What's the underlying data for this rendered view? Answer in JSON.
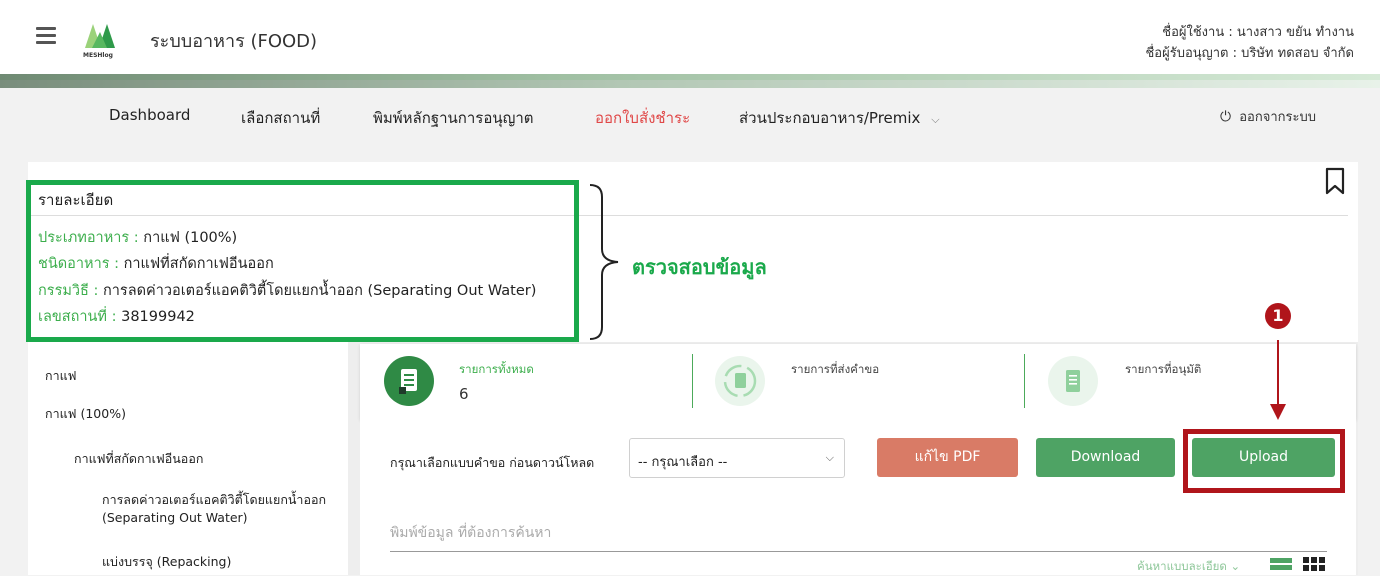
{
  "header": {
    "app_title": "ระบบอาหาร (FOOD)",
    "logo_text": "MESHlog",
    "user_line": "ชื่อผู้ใช้งาน : นางสาว ขยัน ทำงาน",
    "licensee_line": "ชื่อผู้รับอนุญาต : บริษัท ทดสอบ จำกัด",
    "brand_color": "#1aa94b"
  },
  "nav": {
    "items": [
      {
        "label": "Dashboard",
        "active": false
      },
      {
        "label": "เลือกสถานที่",
        "active": false
      },
      {
        "label": "พิมพ์หลักฐานการอนุญาต",
        "active": false
      },
      {
        "label": "ออกใบสั่งชำระ",
        "active": true
      },
      {
        "label": "ส่วนประกอบอาหาร/Premix",
        "active": false
      }
    ],
    "dropdown_indicator": "⌵",
    "logout_icon": "⏻",
    "logout_label": "ออกจากระบบ"
  },
  "details": {
    "title": "รายละเอียด",
    "lines": [
      {
        "label": "ประเภทอาหาร :",
        "value": "กาแฟ (100%)"
      },
      {
        "label": "ชนิดอาหาร :",
        "value": "กาแฟที่สกัดกาเฟอีนออก"
      },
      {
        "label": "กรรมวิธี :",
        "value": "การลดค่าวอเตอร์แอคติวิตี้โดยแยกน้ำออก (Separating Out Water)"
      },
      {
        "label": "เลขสถานที่ :",
        "value": "38199942"
      }
    ],
    "annotation": "ตรวจสอบข้อมูล"
  },
  "sidebar": {
    "items": [
      "กาแฟ",
      "กาแฟ (100%)",
      "กาแฟที่สกัดกาเฟอีนออก",
      "การลดค่าวอเตอร์แอคติวิตี้โดยแยกน้ำออก",
      "(Separating Out Water)",
      "แบ่งบรรจุ (Repacking)"
    ]
  },
  "stats": [
    {
      "label": "รายการทั้งหมด",
      "value": "6",
      "icon": "document-icon"
    },
    {
      "label": "รายการที่ส่งคำขอ",
      "value": "",
      "icon": "refresh-document-icon"
    },
    {
      "label": "รายการที่อนุมัติ",
      "value": "",
      "icon": "approved-document-icon"
    }
  ],
  "actions": {
    "select_label": "กรุณาเลือกแบบคำขอ ก่อนดาวน์โหลด",
    "select_value": "-- กรุณาเลือก --",
    "edit_pdf": "แก้ไข PDF",
    "download": "Download",
    "upload": "Upload",
    "search_placeholder": "พิมพ์ข้อมูล ที่ต้องการค้นหา",
    "advanced_search": "ค้นหาแบบละเอียด ⌄"
  },
  "callout": {
    "number": "❶",
    "color": "#b0151b"
  }
}
